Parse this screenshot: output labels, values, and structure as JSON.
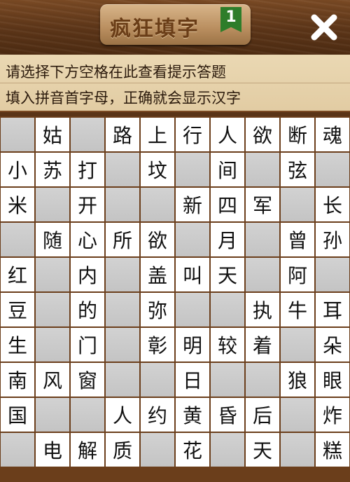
{
  "header": {
    "title": "疯狂填字",
    "level": "1",
    "close_icon": "close-x-icon"
  },
  "hints": {
    "line1": "请选择下方空格在此查看提示答题",
    "line2": "填入拼音首字母，正确就会显示汉字"
  },
  "board": {
    "rows": [
      [
        "",
        "姑",
        "",
        "路",
        "上",
        "行",
        "人",
        "欲",
        "断",
        "魂"
      ],
      [
        "小",
        "苏",
        "打",
        "",
        "坟",
        "",
        "间",
        "",
        "弦",
        ""
      ],
      [
        "米",
        "",
        "开",
        "",
        "",
        "新",
        "四",
        "军",
        "",
        "长"
      ],
      [
        "",
        "随",
        "心",
        "所",
        "欲",
        "",
        "月",
        "",
        "曾",
        "孙"
      ],
      [
        "红",
        "",
        "内",
        "",
        "盖",
        "叫",
        "天",
        "",
        "阿",
        ""
      ],
      [
        "豆",
        "",
        "的",
        "",
        "弥",
        "",
        "",
        "执",
        "牛",
        "耳"
      ],
      [
        "生",
        "",
        "门",
        "",
        "彰",
        "明",
        "较",
        "着",
        "",
        "朵"
      ],
      [
        "南",
        "风",
        "窗",
        "",
        "",
        "日",
        "",
        "",
        "狼",
        "眼"
      ],
      [
        "国",
        "",
        "",
        "人",
        "约",
        "黄",
        "昏",
        "后",
        "",
        "炸"
      ],
      [
        "",
        "电",
        "解",
        "质",
        "",
        "花",
        "",
        "天",
        "",
        "糕"
      ]
    ]
  },
  "colors": {
    "wood_dark": "#5a3417",
    "wood_light": "#7a4a24",
    "hint_bg": "#e4cfa6",
    "cell_white": "#ffffff",
    "cell_blank": "#c8c8c8",
    "badge_green": "#2e7d2a"
  }
}
